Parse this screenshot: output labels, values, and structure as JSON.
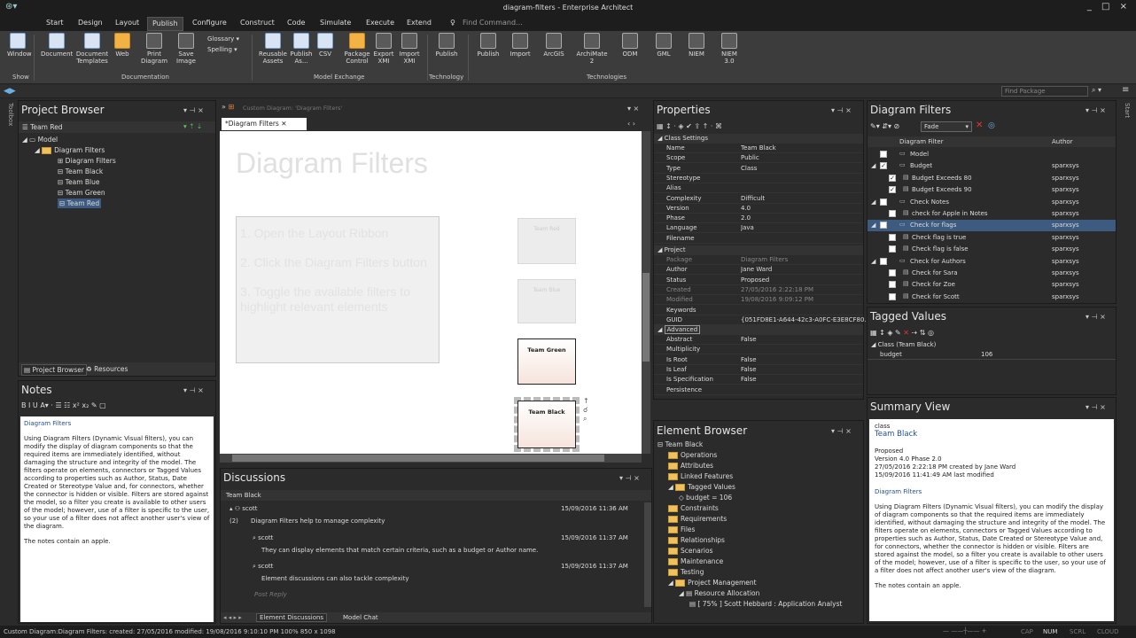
{
  "window": {
    "title": "diagram-filters - Enterprise Architect",
    "controls": "_ □ ×"
  },
  "menu": {
    "items": [
      "Start",
      "Design",
      "Layout",
      "Publish",
      "Configure",
      "Construct",
      "Code",
      "Simulate",
      "Execute",
      "Extend"
    ],
    "search_placeholder": "Find Command..."
  },
  "ribbon": {
    "buttons": [
      "Window",
      "Document",
      "Document Templates",
      "Web",
      "Print Diagram",
      "Save Image",
      "Glossary",
      "Spelling",
      "Reusable Assets",
      "Publish As...",
      "CSV",
      "Package Control",
      "Export XMI",
      "Import XMI",
      "Publish",
      "Publish",
      "Import",
      "ArcGIS",
      "ArchiMate 2",
      "ODM",
      "GML",
      "NIEM",
      "NIEM 3.0"
    ],
    "groups": [
      "Show",
      "Documentation",
      "Model Exchange",
      "Technology",
      "Technologies"
    ]
  },
  "quickbar": {
    "find_package": "Find Package"
  },
  "project_browser": {
    "title": "Project Browser",
    "root": "Team Red",
    "items": [
      "Model",
      "Diagram Filters",
      "Diagram Filters",
      "Team Black",
      "Team Blue",
      "Team Green",
      "Team Red"
    ],
    "tabs": [
      "Project Browser",
      "Resources"
    ]
  },
  "notes": {
    "title": "Notes",
    "heading": "Diagram Filters",
    "body": "Using Diagram Filters (Dynamic Visual filters), you can modify the display of diagram components so that the required items are immediately identified, without damaging the structure and integrity of the model. The filters operate on elements, connectors or Tagged Values according to properties such as Author, Status, Date Created or Stereotype Value and, for connectors, whether the connector is hidden or visible. Filters are stored against the model, so a filter you create is available to other users of the model; however, use of a filter is specific to the user, so your use of a filter does not affect another user's view of the diagram.",
    "footer": "The notes contain an apple."
  },
  "diagram": {
    "breadcrumb": "Custom Diagram: 'Diagram Filters'",
    "tab": "*Diagram Filters",
    "title": "Diagram Filters",
    "steps": [
      "1. Open the Layout Ribbon",
      "2. Click the Diagram Filters button",
      "3. Toggle the available filters to highlight relevant elements"
    ],
    "elements": [
      "Team Red",
      "Team Blue",
      "Team Green",
      "Team Black"
    ]
  },
  "discussions": {
    "title": "Discussions",
    "subject": "Team Black",
    "posts": [
      {
        "author": "scott",
        "date": "15/09/2016 11:36 AM",
        "text": "Diagram Filters help to manage complexity",
        "count": "(2)"
      },
      {
        "author": "scott",
        "date": "15/09/2016 11:37 AM",
        "text": "They can display elements that match certain criteria, such as a budget or Author name."
      },
      {
        "author": "scott",
        "date": "15/09/2016 11:37 AM",
        "text": "Element discussions can also tackle complexity"
      }
    ],
    "post_reply": "Post Reply",
    "tabs": [
      "Element Discussions",
      "Model Chat"
    ]
  },
  "properties": {
    "title": "Properties",
    "sections": {
      "class": "Class Settings",
      "project": "Project",
      "advanced": "Advanced"
    },
    "class_rows": [
      [
        "Name",
        "Team Black"
      ],
      [
        "Scope",
        "Public"
      ],
      [
        "Type",
        "Class"
      ],
      [
        "Stereotype",
        ""
      ],
      [
        "Alias",
        ""
      ],
      [
        "Complexity",
        "Difficult"
      ],
      [
        "Version",
        "4.0"
      ],
      [
        "Phase",
        "2.0"
      ],
      [
        "Language",
        "Java"
      ],
      [
        "Filename",
        ""
      ]
    ],
    "project_rows": [
      [
        "Package",
        "Diagram Filters"
      ],
      [
        "Author",
        "Jane Ward"
      ],
      [
        "Status",
        "Proposed"
      ],
      [
        "Created",
        "27/05/2016 2:22:18 PM"
      ],
      [
        "Modified",
        "19/08/2016 9:09:12 PM"
      ],
      [
        "Keywords",
        ""
      ],
      [
        "GUID",
        "{051FD8E1-A644-42c3-A0FC-E3E8CF80..."
      ]
    ],
    "advanced_rows": [
      [
        "Abstract",
        "False"
      ],
      [
        "Multiplicity",
        ""
      ],
      [
        "Is Root",
        "False"
      ],
      [
        "Is Leaf",
        "False"
      ],
      [
        "Is Specification",
        "False"
      ],
      [
        "Persistence",
        ""
      ]
    ]
  },
  "element_browser": {
    "title": "Element Browser",
    "root": "Team Black",
    "items": [
      "Operations",
      "Attributes",
      "Linked Features",
      "Tagged Values",
      "budget = 106",
      "Constraints",
      "Requirements",
      "Files",
      "Relationships",
      "Scenarios",
      "Maintenance",
      "Testing",
      "Project Management",
      "Resource Allocation",
      "[ 75% ] Scott Hebbard : Application Analyst"
    ]
  },
  "diagram_filters": {
    "title": "Diagram Filters",
    "mode": "Fade",
    "col1": "Diagram Filter",
    "col2": "Author",
    "rows": [
      {
        "name": "Model",
        "author": "",
        "checked": false
      },
      {
        "name": "Budget",
        "author": "sparxsys",
        "checked": true
      },
      {
        "name": "Budget Exceeds 80",
        "author": "sparxsys",
        "checked": true
      },
      {
        "name": "Budget Exceeds 90",
        "author": "sparxsys",
        "checked": true
      },
      {
        "name": "Check Notes",
        "author": "sparxsys",
        "checked": false
      },
      {
        "name": "check for Apple in Notes",
        "author": "sparxsys",
        "checked": false
      },
      {
        "name": "Check for flags",
        "author": "sparxsys",
        "checked": false
      },
      {
        "name": "Check flag is true",
        "author": "sparxsys",
        "checked": false
      },
      {
        "name": "Check flag is false",
        "author": "sparxsys",
        "checked": false
      },
      {
        "name": "Check for Authors",
        "author": "sparxsys",
        "checked": false
      },
      {
        "name": "Check for Sara",
        "author": "sparxsys",
        "checked": false
      },
      {
        "name": "Check for Zoe",
        "author": "sparxsys",
        "checked": false
      },
      {
        "name": "Check for Scott",
        "author": "sparxsys",
        "checked": false
      }
    ]
  },
  "tagged_values": {
    "title": "Tagged Values",
    "group": "Class (Team Black)",
    "tag": "budget",
    "value": "106"
  },
  "summary": {
    "title": "Summary View",
    "kind": "class",
    "name": "Team Black",
    "status": "Proposed",
    "version": "Version 4.0  Phase 2.0",
    "created": "27/05/2016 2:22:18 PM created by Jane Ward",
    "modified": "15/09/2016 11:41:49 AM last modified",
    "heading": "Diagram Filters",
    "body": "Using Diagram Filters (Dynamic Visual filters), you can modify the display of diagram components so that the required items are immediately identified, without damaging the structure and integrity of the model. The filters operate on elements, connectors or Tagged Values according to properties such as Author, Status, Date Created or Stereotype Value and, for connectors, whether the connector is hidden or visible. Filters are stored against the model, so a filter you create is available to other users of the model; however, use of a filter is specific to the user, so your use of a filter does not affect another user's view of the diagram.",
    "footer": "The notes contain an apple."
  },
  "statusbar": {
    "left": "Custom Diagram:Diagram Filters:  created: 27/05/2016  modified: 19/08/2016 9:10:10 PM   100%   850 x 1098",
    "right": [
      "CAP",
      "NUM",
      "SCRL",
      "CLOUD"
    ]
  },
  "colors": {
    "accent": "#2b579a",
    "background": "#2b2b2b"
  }
}
